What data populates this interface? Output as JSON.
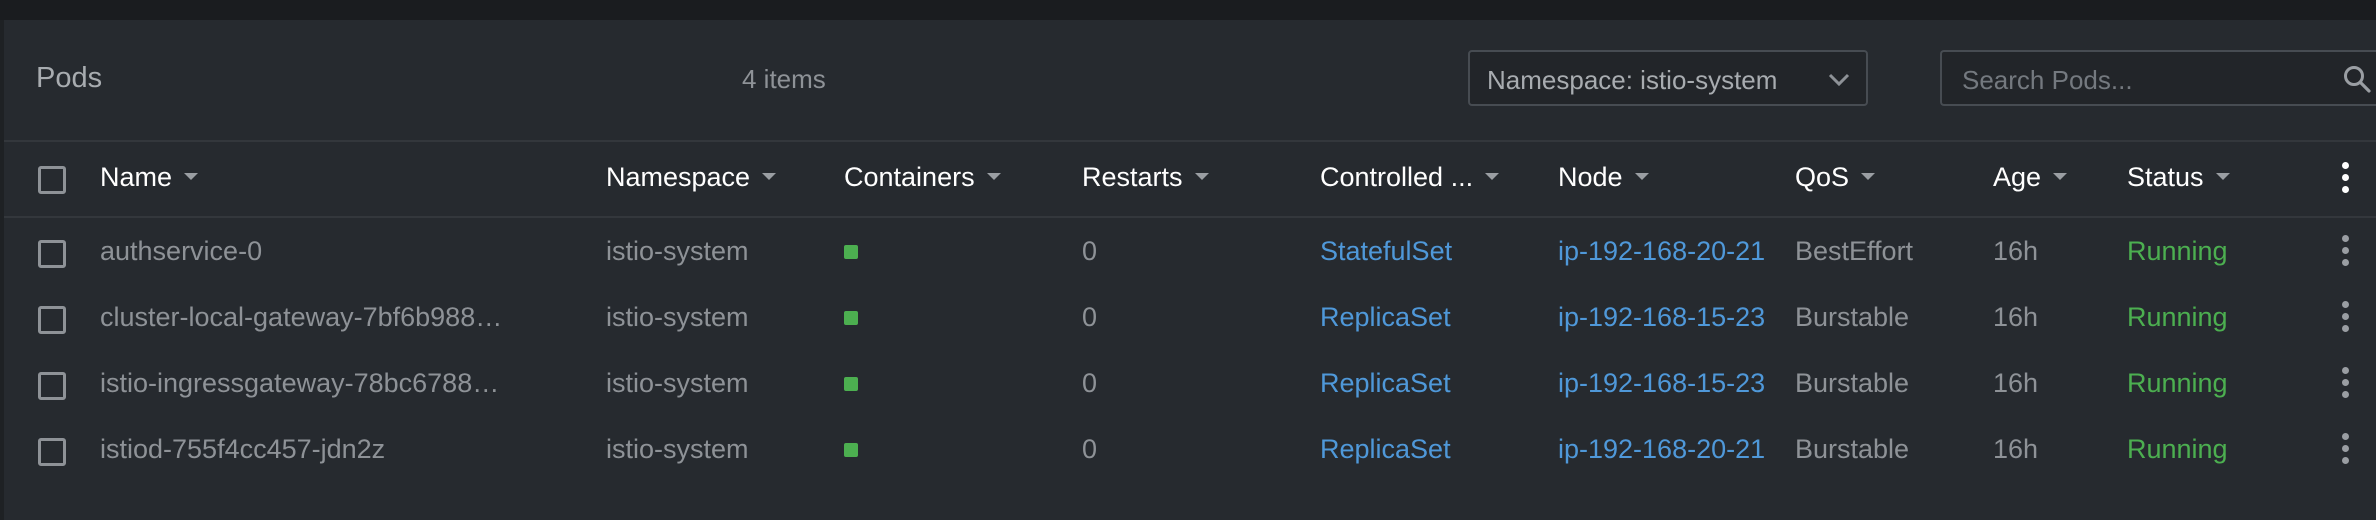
{
  "header": {
    "title": "Pods",
    "count": "4 items",
    "namespace_select": "Namespace: istio-system",
    "search_placeholder": "Search Pods..."
  },
  "columns": {
    "name": "Name",
    "namespace": "Namespace",
    "containers": "Containers",
    "restarts": "Restarts",
    "controlled_by": "Controlled ...",
    "node": "Node",
    "qos": "QoS",
    "age": "Age",
    "status": "Status"
  },
  "rows": [
    {
      "name": "authservice-0",
      "namespace": "istio-system",
      "restarts": "0",
      "controlled_by": "StatefulSet",
      "node": "ip-192-168-20-21",
      "qos": "BestEffort",
      "age": "16h",
      "status": "Running"
    },
    {
      "name": "cluster-local-gateway-7bf6b988…",
      "namespace": "istio-system",
      "restarts": "0",
      "controlled_by": "ReplicaSet",
      "node": "ip-192-168-15-23",
      "qos": "Burstable",
      "age": "16h",
      "status": "Running"
    },
    {
      "name": "istio-ingressgateway-78bc6788…",
      "namespace": "istio-system",
      "restarts": "0",
      "controlled_by": "ReplicaSet",
      "node": "ip-192-168-15-23",
      "qos": "Burstable",
      "age": "16h",
      "status": "Running"
    },
    {
      "name": "istiod-755f4cc457-jdn2z",
      "namespace": "istio-system",
      "restarts": "0",
      "controlled_by": "ReplicaSet",
      "node": "ip-192-168-20-21",
      "qos": "Burstable",
      "age": "16h",
      "status": "Running"
    }
  ],
  "colors": {
    "link": "#4f98d9",
    "status_running": "#4caf50",
    "container_ready": "#4caf50"
  },
  "icons": {
    "namespace_dropdown": "chevron-down-icon",
    "search": "search-icon",
    "row_menu": "kebab-menu-icon",
    "container_state": "container-status-icon"
  }
}
